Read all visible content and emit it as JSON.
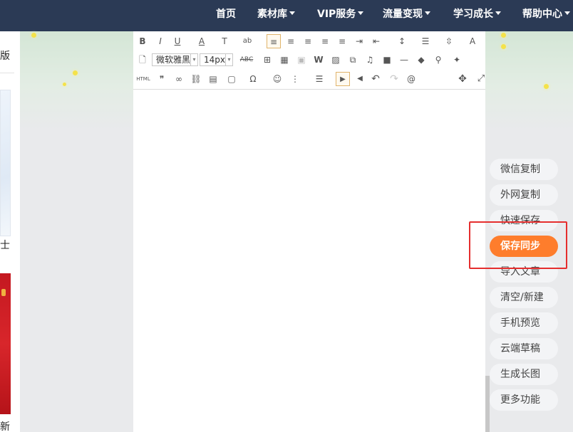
{
  "nav": {
    "items": [
      {
        "label": "首页",
        "dropdown": false
      },
      {
        "label": "素材库",
        "dropdown": true
      },
      {
        "label": "VIP服务",
        "dropdown": true
      },
      {
        "label": "流量变现",
        "dropdown": true
      },
      {
        "label": "学习成长",
        "dropdown": true
      },
      {
        "label": "帮助中心",
        "dropdown": true
      }
    ]
  },
  "left_panel": {
    "fragments": [
      "版",
      "士",
      "新"
    ]
  },
  "editor": {
    "font_family": "微软雅黑",
    "font_size": "14px",
    "html_label": "HTML",
    "toolbar_row1": [
      {
        "glyph": "B",
        "name": "bold-icon"
      },
      {
        "glyph": "I",
        "name": "italic-icon"
      },
      {
        "glyph": "U",
        "name": "underline-icon"
      },
      {
        "glyph": "A",
        "name": "font-color-icon"
      },
      {
        "glyph": "T",
        "name": "text-style-icon"
      },
      {
        "glyph": "ab",
        "name": "highlight-icon"
      },
      {
        "glyph": "≡",
        "name": "align-left-icon"
      },
      {
        "glyph": "≡",
        "name": "align-center-icon"
      },
      {
        "glyph": "≡",
        "name": "align-right-icon"
      },
      {
        "glyph": "≡",
        "name": "align-justify-icon"
      },
      {
        "glyph": "≡",
        "name": "distribute-icon"
      },
      {
        "glyph": "⇥",
        "name": "indent-icon"
      },
      {
        "glyph": "⇤",
        "name": "outdent-icon"
      },
      {
        "glyph": "↕",
        "name": "line-height-icon"
      },
      {
        "glyph": "☰",
        "name": "paragraph-spacing-icon"
      },
      {
        "glyph": "⇳",
        "name": "letter-spacing-icon"
      },
      {
        "glyph": "A",
        "name": "clear-format-icon"
      }
    ],
    "toolbar_row2": [
      {
        "glyph": "🗋",
        "name": "new-page-icon"
      },
      {
        "glyph": "ABC",
        "name": "strikethrough-icon"
      },
      {
        "glyph": "⊞",
        "name": "table-icon"
      },
      {
        "glyph": "▦",
        "name": "image-grid-icon"
      },
      {
        "glyph": "▣",
        "name": "template-icon"
      },
      {
        "glyph": "W",
        "name": "word-icon"
      },
      {
        "glyph": "▨",
        "name": "image-icon"
      },
      {
        "glyph": "⧉",
        "name": "multi-image-icon"
      },
      {
        "glyph": "♫",
        "name": "music-icon"
      },
      {
        "glyph": "■",
        "name": "video-icon"
      },
      {
        "glyph": "—",
        "name": "horizontal-rule-icon"
      },
      {
        "glyph": "◆",
        "name": "eraser-icon"
      },
      {
        "glyph": "⚲",
        "name": "format-brush-icon"
      },
      {
        "glyph": "✦",
        "name": "magic-wand-icon"
      }
    ],
    "toolbar_row3": [
      {
        "glyph": "❞",
        "name": "quote-icon"
      },
      {
        "glyph": "∞",
        "name": "link-icon"
      },
      {
        "glyph": "⛓",
        "name": "unlink-icon"
      },
      {
        "glyph": "▤",
        "name": "card-icon"
      },
      {
        "glyph": "▢",
        "name": "frame-icon"
      },
      {
        "glyph": "Ω",
        "name": "special-char-icon"
      },
      {
        "glyph": "☺",
        "name": "emoji-icon"
      },
      {
        "glyph": "⋮",
        "name": "ordered-list-icon"
      },
      {
        "glyph": "☰",
        "name": "unordered-list-icon"
      },
      {
        "glyph": "▶",
        "name": "ltr-icon"
      },
      {
        "glyph": "◀",
        "name": "rtl-icon"
      },
      {
        "glyph": "↶",
        "name": "undo-icon"
      },
      {
        "glyph": "↷",
        "name": "redo-icon"
      },
      {
        "glyph": "@",
        "name": "mention-icon"
      },
      {
        "glyph": "✥",
        "name": "move-icon"
      },
      {
        "glyph": "⤢",
        "name": "fullscreen-icon"
      }
    ]
  },
  "side_menu": [
    {
      "label": "微信复制",
      "active": false
    },
    {
      "label": "外网复制",
      "active": false
    },
    {
      "label": "快速保存",
      "active": false
    },
    {
      "label": "保存同步",
      "active": true
    },
    {
      "label": "导入文章",
      "active": false
    },
    {
      "label": "清空/新建",
      "active": false
    },
    {
      "label": "手机预览",
      "active": false
    },
    {
      "label": "云端草稿",
      "active": false
    },
    {
      "label": "生成长图",
      "active": false
    },
    {
      "label": "更多功能",
      "active": false
    }
  ],
  "colors": {
    "nav_bg": "#2b3a55",
    "accent": "#fe7d2c",
    "highlight_border": "#e52e2e"
  }
}
